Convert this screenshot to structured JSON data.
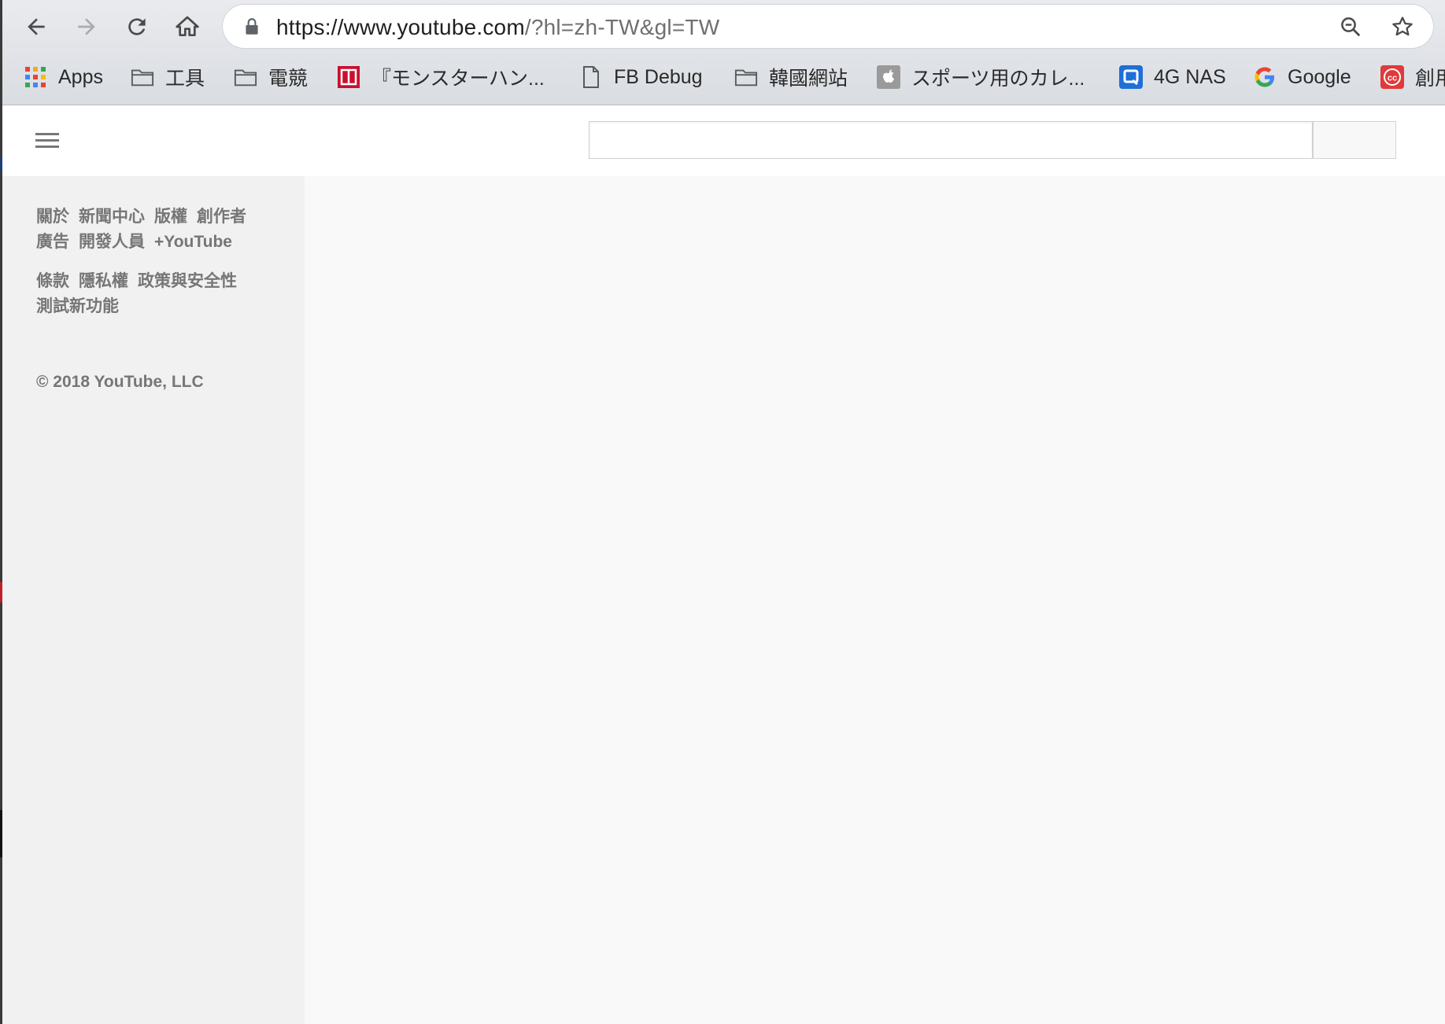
{
  "browser": {
    "url_host": "https://www.youtube.com",
    "url_rest": "/?hl=zh-TW&gl=TW",
    "bookmarks": [
      {
        "label": "Apps",
        "icon": "apps-grid-icon"
      },
      {
        "label": "工具",
        "icon": "folder-icon"
      },
      {
        "label": "電競",
        "icon": "folder-icon"
      },
      {
        "label": "『モンスターハン...",
        "icon": "game-site-icon"
      },
      {
        "label": "FB Debug",
        "icon": "page-icon"
      },
      {
        "label": "韓國網站",
        "icon": "folder-icon"
      },
      {
        "label": "スポーツ用のカレ...",
        "icon": "apple-icon"
      },
      {
        "label": "4G NAS",
        "icon": "nas-icon"
      },
      {
        "label": "Google",
        "icon": "google-icon"
      },
      {
        "label": "創用",
        "icon": "cc-icon"
      }
    ]
  },
  "masthead": {
    "search_placeholder": "",
    "search_button_label": ""
  },
  "sidebar": {
    "links_group1": [
      "關於",
      "新聞中心",
      "版權",
      "創作者",
      "廣告",
      "開發人員",
      "+YouTube"
    ],
    "links_group2": [
      "條款",
      "隱私權",
      "政策與安全性",
      "測試新功能"
    ],
    "copyright": "© 2018 YouTube, LLC"
  },
  "colors": {
    "sidebar_bg": "#f1f1f1",
    "main_bg": "#f9f9f9",
    "footer_text": "#767676"
  }
}
